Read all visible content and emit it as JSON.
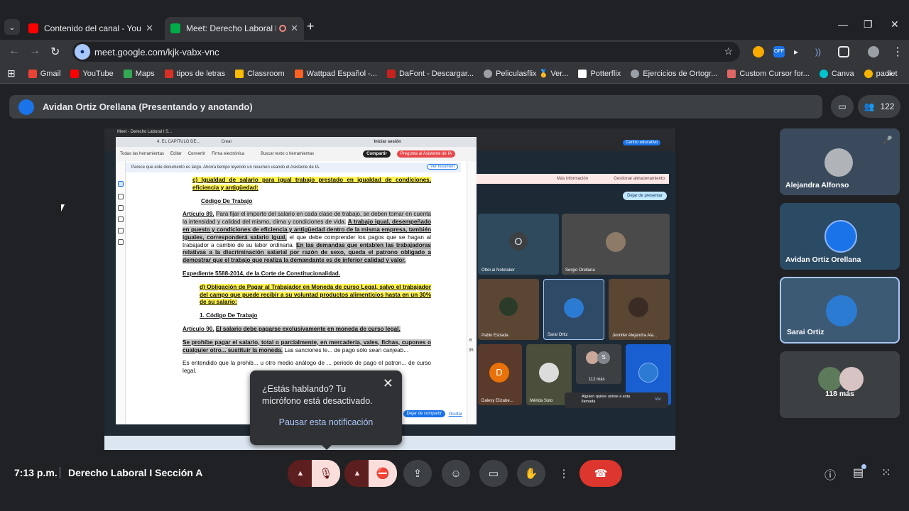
{
  "browser": {
    "tabs": [
      {
        "title": "Contenido del canal - YouTube",
        "color": "#ff0000"
      },
      {
        "title": "Meet: Derecho Laboral I Secc",
        "color": "#00ac47"
      }
    ],
    "url": "meet.google.com/kjk-vabx-vnc",
    "ext_badge": "OFF",
    "bookmarks": [
      {
        "label": "Gmail",
        "color": "#ea4335"
      },
      {
        "label": "YouTube",
        "color": "#ff0000"
      },
      {
        "label": "Maps",
        "color": "#34a853"
      },
      {
        "label": "tipos de letras",
        "color": "#d93025"
      },
      {
        "label": "Classroom",
        "color": "#fbbc04"
      },
      {
        "label": "Wattpad Español -...",
        "color": "#ff6122"
      },
      {
        "label": "DaFont - Descargar...",
        "color": "#c5221f"
      },
      {
        "label": "Peliculasflix 🥇 Ver...",
        "color": "#9aa0a6"
      },
      {
        "label": "Potterflix",
        "color": "#ffffff"
      },
      {
        "label": "Ejercicios de Ortogr...",
        "color": "#9aa0a6"
      },
      {
        "label": "Custom Cursor for...",
        "color": "#e06666"
      },
      {
        "label": "Canva",
        "color": "#00c4cc"
      },
      {
        "label": "padlet",
        "color": "#f4b400"
      }
    ]
  },
  "meet": {
    "presenter_bar": "Avidan Ortiz Orellana (Presentando y anotando)",
    "participant_count": "122",
    "tiles": [
      {
        "name": "Alejandra Alfonso",
        "bg": "#3a4a5c"
      },
      {
        "name": "Avidan Ortiz Orellana",
        "bg": "#2b4a63"
      },
      {
        "name": "Sarai Ortiz",
        "bg": "#3d5a74"
      },
      {
        "name": "118 más",
        "bg": "#3c4043"
      }
    ],
    "clock": "7:13 p.m.",
    "meeting_name": "Derecho Laboral I Sección A",
    "toast": {
      "message": "¿Estás hablando? Tu micrófono está desactivado.",
      "action": "Pausar esta notificación"
    }
  },
  "shared_screen": {
    "inner_tab": "Meet - Derecho Laboral I S...",
    "pdf_title": "4. EL CAPÍTULO DE...",
    "crear": "Crear",
    "iniciar_sesion": "Iniciar sesión",
    "menu": [
      "Todas las herramientas",
      "Editar",
      "Convertir",
      "Firma electrónica",
      "Buscar texto o herramientas"
    ],
    "compartir": "Compartir",
    "asistente": "Pregunta al Asistente de IA",
    "banner": "Parece que este documento es largo. Ahorra tiempo leyendo un resumen usando el Asistente de IA.",
    "ver_resumen": "Ver resumen",
    "notif_strip_left": "Más información",
    "notif_strip_right": "Gestionar almacenamiento",
    "dejar_presentar": "Dejar de presentar",
    "dejar_compartir": "Dejar de compartir",
    "ocultar": "Ocultar",
    "otter": "Otter.ai Notetaker",
    "sergio": "Sergio Orellana",
    "pablo": "Pablo Estrada",
    "sarai": "Sarai Ortiz",
    "jennifer": "Jennifer Alejandra Ala...",
    "dalesy": "Dalesy Elizabe...",
    "merida": "Mérida Soto",
    "mas112": "112 más",
    "join_req": "Alguien quiere unirse a esta llamada",
    "ver": "Ver",
    "centro": "Centro educativo",
    "page_num": "6",
    "page_total": "35",
    "doc": {
      "c_item": "c) Igualdad de salario para igual trabajo prestado en igualdad de condiciones, eficiencia y antigüedad:",
      "codigo1": "Código De Trabajo",
      "art89_head": "Artículo 89.",
      "art89_a": "Para fijar el importe del salario en cada clase de trabajo, se deben tomar en cuenta la intensidad y calidad del mismo, clima y condiciones de vida.",
      "art89_b": "A trabajo igual, desempeñado en puesto y condiciones de eficiencia y antigüedad dentro de la misma empresa, también iguales, corresponderá salario igual,",
      "art89_c": "el que debe comprender los pagos que se hagan al trabajador a cambio de su labor ordinaria.",
      "art89_d": "En las demandas que entablen las trabajadoras relativas a la discriminación salarial por razón de sexo, queda el patrono obligado a demostrar que el trabajo que realiza la demandante es de inferior calidad y valor.",
      "expediente": "Expediente 5588-2014, de la Corte de Constitucionalidad.",
      "d_item": "d) Obligación de Pagar al Trabajador en Moneda de curso Legal, salvo el trabajador del campo que puede recibir a su voluntad productos alimenticios hasta en un 30% de su salario:",
      "codigo2": "1. Código De Trabajo",
      "art90_head": "Artículo 90.",
      "art90_a": "El salario debe pagarse exclusivamente en moneda de curso legal.",
      "art90_b": "Se prohíbe pagar el salario, total o parcialmente, en mercadería, vales, fichas, cupones o cualquier otro... sustituir la moneda.",
      "art90_c": "Las sanciones le... de pago sólo sean canjeab...",
      "art90_d": "Es entendido que la prohib... u otro medio análogo de ... periodo de pago el patron... de curso legal."
    }
  }
}
